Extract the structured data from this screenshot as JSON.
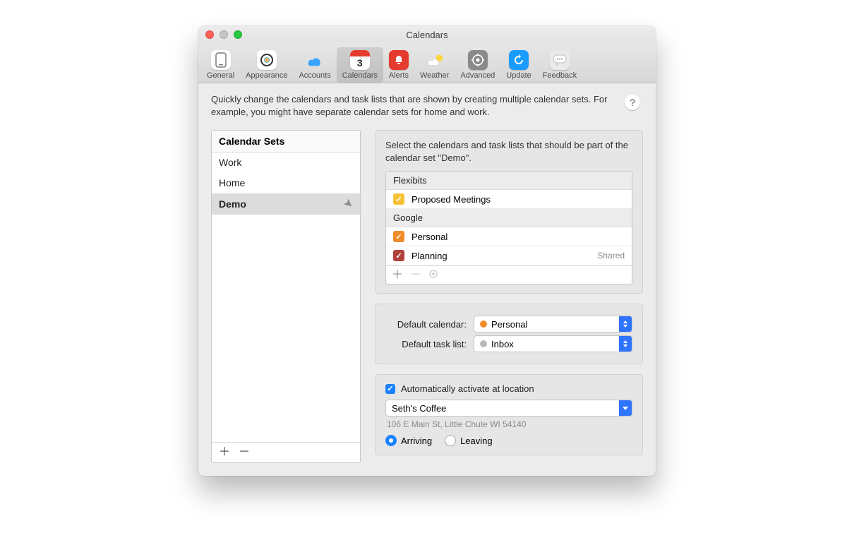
{
  "window": {
    "title": "Calendars"
  },
  "toolbar": {
    "items": [
      {
        "label": "General"
      },
      {
        "label": "Appearance"
      },
      {
        "label": "Accounts"
      },
      {
        "label": "Calendars"
      },
      {
        "label": "Alerts"
      },
      {
        "label": "Weather"
      },
      {
        "label": "Advanced"
      },
      {
        "label": "Update"
      },
      {
        "label": "Feedback"
      }
    ],
    "calendar_day": "3"
  },
  "intro": "Quickly change the calendars and task lists that are shown by creating multiple calendar sets. For example, you might have separate calendar sets for home and work.",
  "sets": {
    "header": "Calendar Sets",
    "items": [
      {
        "name": "Work"
      },
      {
        "name": "Home"
      },
      {
        "name": "Demo"
      }
    ]
  },
  "calendars_panel": {
    "intro": "Select the calendars and task lists that should be part of the calendar set \"Demo\".",
    "groups": [
      {
        "name": "Flexibits",
        "items": [
          {
            "name": "Proposed Meetings",
            "color": "#f4c338",
            "checked": true,
            "tag": ""
          }
        ]
      },
      {
        "name": "Google",
        "items": [
          {
            "name": "Personal",
            "color": "#f08a2a",
            "checked": true,
            "tag": ""
          },
          {
            "name": "Planning",
            "color": "#b1413b",
            "checked": true,
            "tag": "Shared"
          }
        ]
      }
    ]
  },
  "defaults": {
    "calendar_label": "Default calendar:",
    "calendar_value": "Personal",
    "calendar_color": "#f08a2a",
    "tasklist_label": "Default task list:",
    "tasklist_value": "Inbox",
    "tasklist_color": "#b9b9b9"
  },
  "location": {
    "auto_label": "Automatically activate at location",
    "name": "Seth's Coffee",
    "address": "106 E Main St, Little Chute WI 54140",
    "arriving_label": "Arriving",
    "leaving_label": "Leaving"
  }
}
